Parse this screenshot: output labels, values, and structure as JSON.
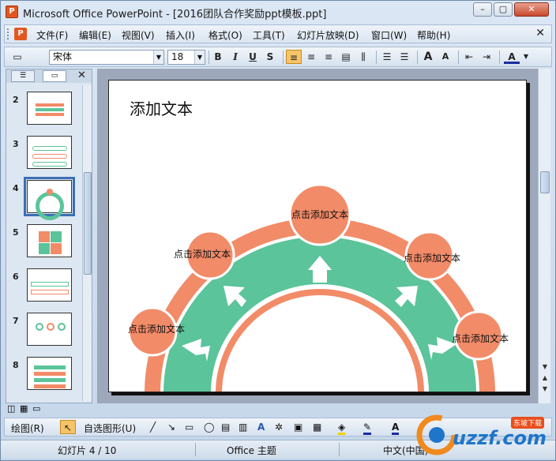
{
  "window": {
    "title": "Microsoft Office PowerPoint - [2016团队合作奖励ppt模板.ppt]",
    "app_icon_letter": "P",
    "minimize": "–",
    "restore": "▢",
    "close": "✕"
  },
  "menubar": {
    "items": [
      "文件(F)",
      "编辑(E)",
      "视图(V)",
      "插入(I)",
      "格式(O)",
      "工具(T)",
      "幻灯片放映(D)",
      "窗口(W)",
      "帮助(H)"
    ],
    "close": "✕"
  },
  "toolbar": {
    "font": "宋体",
    "size": "18",
    "bold": "B",
    "italic": "I",
    "underline": "U",
    "shadow": "S",
    "grow_font": "A",
    "shrink_font": "A",
    "font_color": "A"
  },
  "slides_pane": {
    "thumbnails": [
      {
        "num": "2"
      },
      {
        "num": "3"
      },
      {
        "num": "4"
      },
      {
        "num": "5"
      },
      {
        "num": "6"
      },
      {
        "num": "7"
      },
      {
        "num": "8"
      }
    ],
    "selected": "4",
    "close": "✕"
  },
  "slide": {
    "title": "添加文本",
    "nodes": [
      {
        "label": "点击添加文本"
      },
      {
        "label": "点击添加文本"
      },
      {
        "label": "点击添加文本"
      },
      {
        "label": "点击添加文本"
      },
      {
        "label": "点击添加文本"
      }
    ],
    "colors": {
      "orange": "#f28b68",
      "green": "#5bc49a"
    }
  },
  "drawbar": {
    "draw": "绘图(R)",
    "autoshapes": "自选图形(U)"
  },
  "statusbar": {
    "slide_info": "幻灯片 4 / 10",
    "theme": "Office 主题",
    "language": "中文(中国)"
  },
  "watermark": {
    "text": "uzzf.com",
    "sub": "东坡下载"
  }
}
